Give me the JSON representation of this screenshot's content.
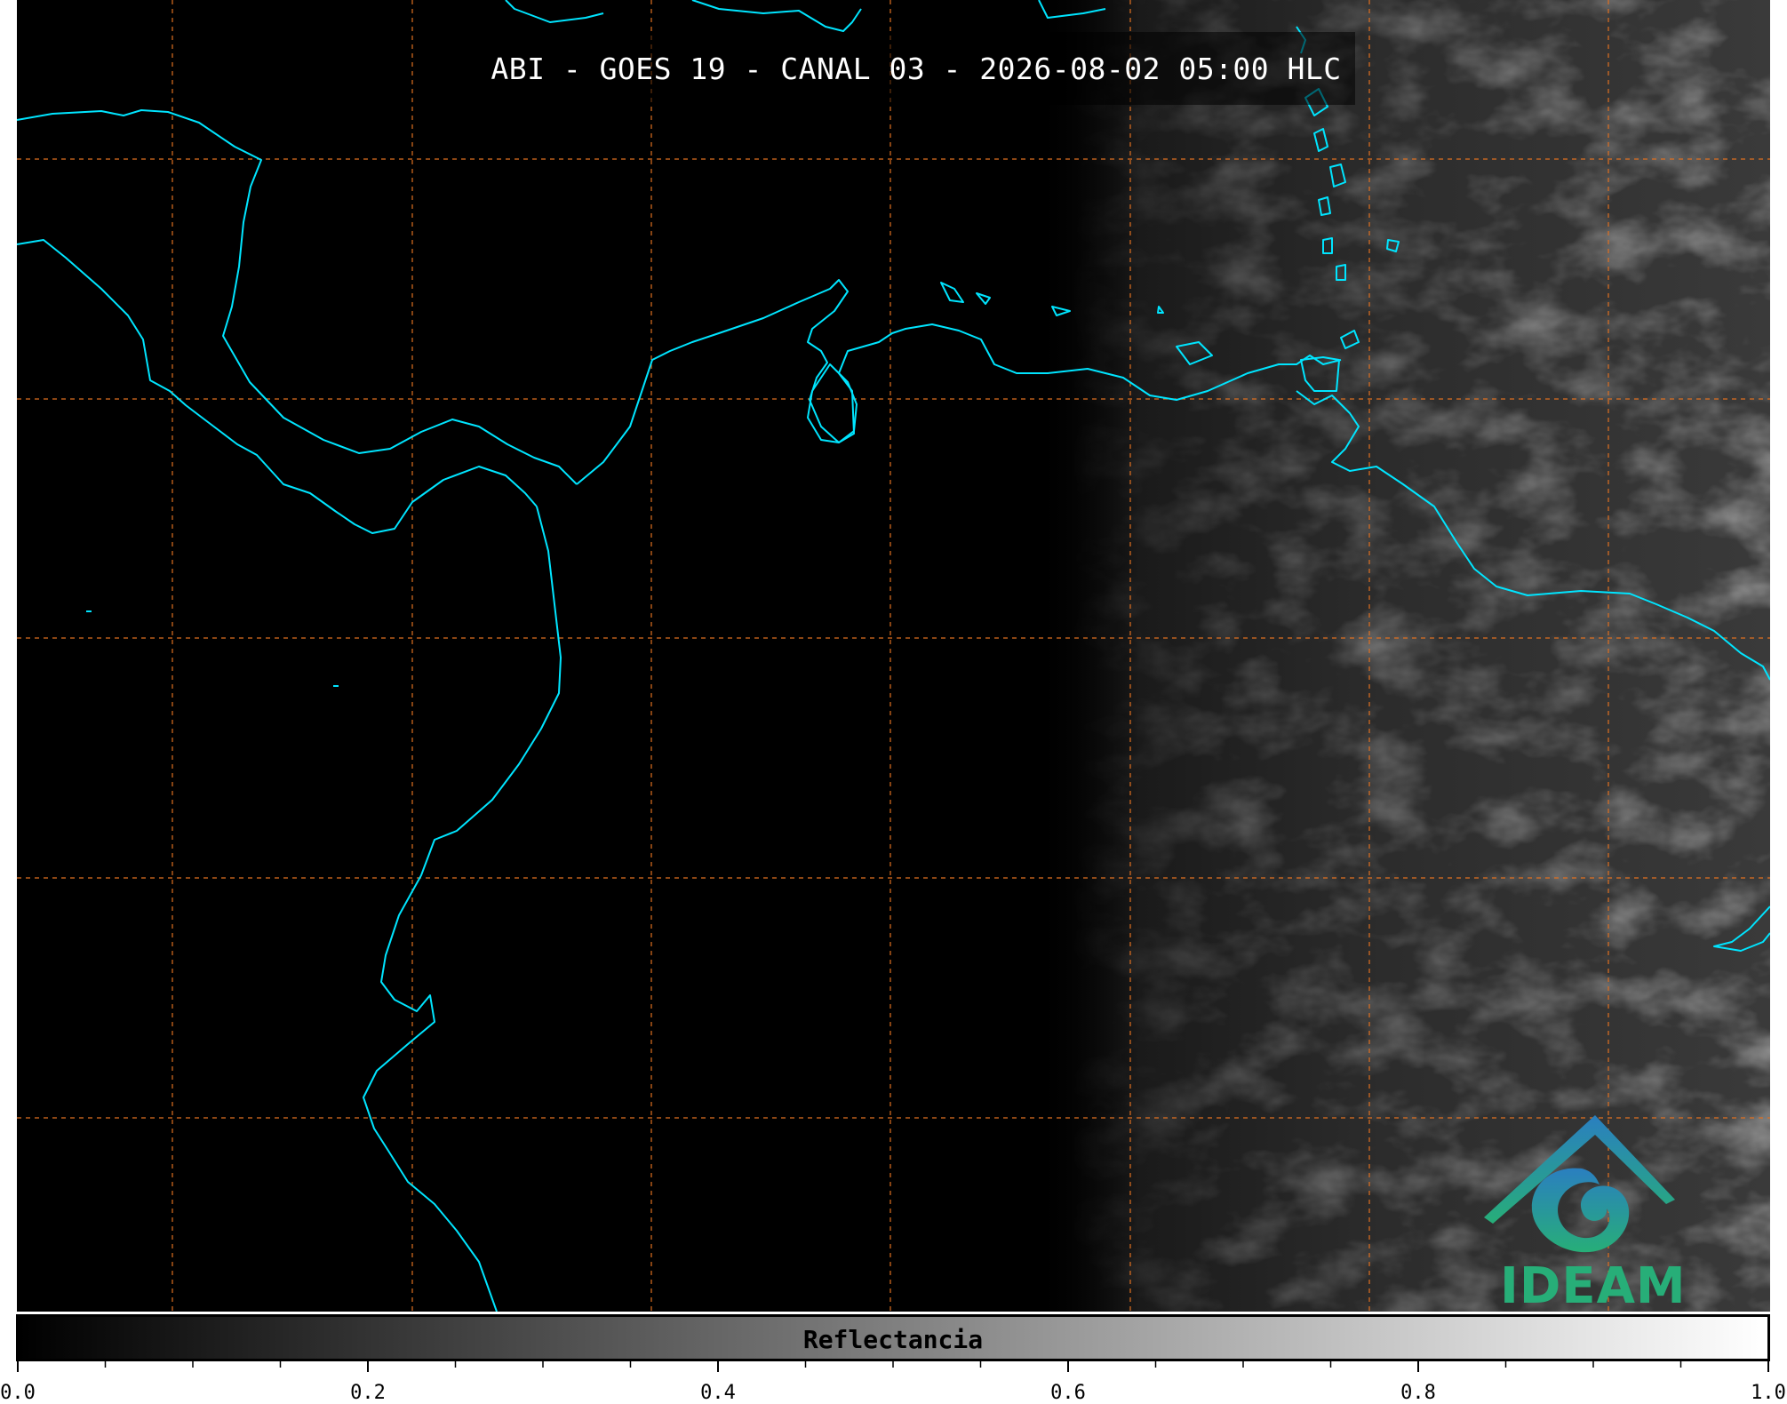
{
  "title": "ABI - GOES 19 - CANAL 03 - 2026-08-02 05:00 HLC",
  "colorbar": {
    "label": "Reflectancia",
    "ticks": [
      "0.0",
      "0.2",
      "0.4",
      "0.6",
      "0.8",
      "1.0"
    ],
    "range": [
      0.0,
      1.0
    ],
    "colormap": [
      "#000000",
      "#ffffff"
    ]
  },
  "logo": {
    "text": "IDEAM",
    "icon": "ideam-mountain-swirl-logo",
    "colors": [
      "#2a7fc0",
      "#27ae78"
    ]
  },
  "colors": {
    "coastline": "#00e5ff",
    "gridlines": "#e07020",
    "background": "#000000"
  }
}
